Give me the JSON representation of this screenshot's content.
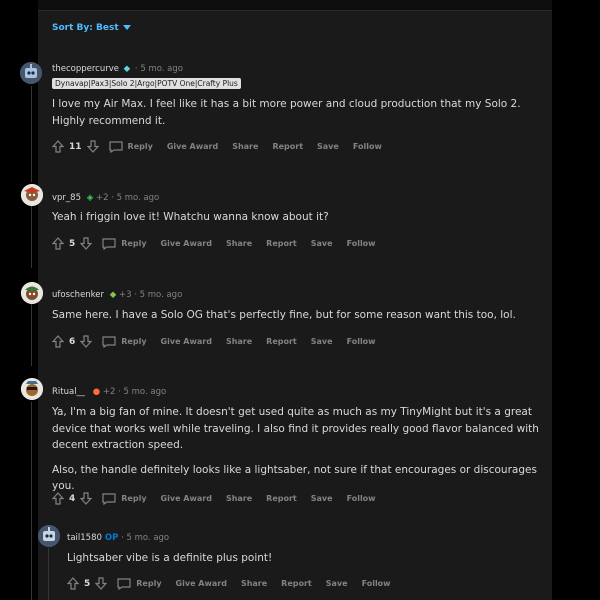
{
  "sort": {
    "label": "Sort By: Best"
  },
  "comments": [
    {
      "user": "thecoppercurve",
      "time": "5 mo. ago",
      "flair": "Dynavap|Pax3|Solo 2|Argo|POTV One|Crafty Plus",
      "body": [
        "I love my Air Max. I feel like it has a bit more power and cloud production that my Solo 2. Highly recommend it."
      ],
      "score": "11"
    },
    {
      "user": "vpr_85",
      "plus": "+2",
      "time": "5 mo. ago",
      "body": [
        "Yeah i friggin love it! Whatchu wanna know about it?"
      ],
      "score": "5"
    },
    {
      "user": "ufoschenker",
      "plus": "+3",
      "time": "5 mo. ago",
      "body": [
        "Same here. I have a Solo OG that's perfectly fine, but for some reason want this too, lol."
      ],
      "score": "6"
    },
    {
      "user": "Ritual__",
      "plus": "+2",
      "time": "5 mo. ago",
      "body": [
        "Ya, I'm a big fan of mine. It doesn't get used quite as much as my TinyMight but it's a great device that works well while traveling. I also find it provides really good flavor balanced with decent extraction speed.",
        "Also, the handle definitely looks like a lightsaber, not sure if that encourages or discourages you."
      ],
      "score": "4"
    },
    {
      "user": "tail1580",
      "op": "OP",
      "time": "5 mo. ago",
      "body": [
        "Lightsaber vibe is a definite plus point!"
      ],
      "score": "5"
    }
  ],
  "actions": {
    "reply": "Reply",
    "award": "Give Award",
    "share": "Share",
    "report": "Report",
    "save": "Save",
    "follow": "Follow"
  },
  "colors": {
    "background": "#1a1a1b",
    "text": "#d7dadc",
    "muted": "#818384",
    "accent": "#4fbcff",
    "op": "#0079d3"
  }
}
